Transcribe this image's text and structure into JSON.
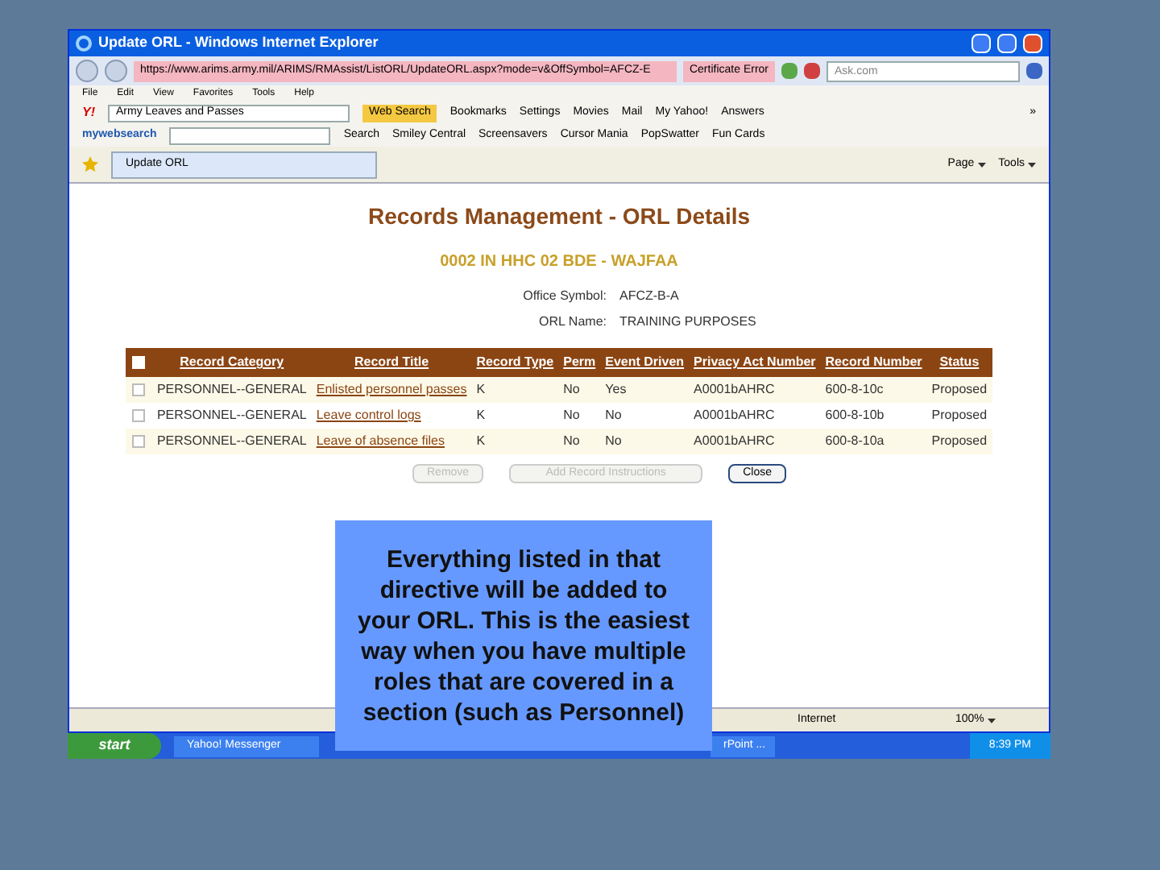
{
  "window": {
    "title": "Update ORL - Windows Internet Explorer"
  },
  "address_bar": {
    "url": "https://www.arims.army.mil/ARIMS/RMAssist/ListORL/UpdateORL.aspx?mode=v&OffSymbol=AFCZ-E",
    "certificate": "Certificate Error",
    "search_placeholder": "Ask.com"
  },
  "menu": [
    "File",
    "Edit",
    "View",
    "Favorites",
    "Tools",
    "Help"
  ],
  "yahoo_toolbar": {
    "logo": "Y!",
    "search_value": "Army Leaves and Passes",
    "search_button": "Web Search",
    "items": [
      "Bookmarks",
      "Settings",
      "Movies",
      "Mail",
      "My Yahoo!",
      "Answers"
    ],
    "more": "»"
  },
  "mywebsearch_toolbar": {
    "logo": "mywebsearch",
    "search_button": "Search",
    "items": [
      "Smiley Central",
      "Screensavers",
      "Cursor Mania",
      "PopSwatter",
      "Fun Cards"
    ]
  },
  "tab": {
    "label": "Update ORL"
  },
  "command_bar": [
    "Page",
    "Tools"
  ],
  "page": {
    "title": "Records Management - ORL Details",
    "subtitle": "0002 IN HHC 02 BDE - WAJFAA",
    "fields": [
      {
        "label": "Office Symbol:",
        "value": "AFCZ-B-A"
      },
      {
        "label": "ORL Name:",
        "value": "TRAINING PURPOSES"
      }
    ],
    "table": {
      "select_all_checked": false,
      "columns": [
        "Record Category",
        "Record Title",
        "Record Type",
        "Perm",
        "Event Driven",
        "Privacy Act Number",
        "Record Number",
        "Status"
      ],
      "rows": [
        {
          "checked": false,
          "cells": [
            "PERSONNEL--GENERAL",
            "Enlisted personnel passes",
            "K",
            "No",
            "Yes",
            "A0001bAHRC",
            "600-8-10c",
            "Proposed"
          ]
        },
        {
          "checked": false,
          "cells": [
            "PERSONNEL--GENERAL",
            "Leave control logs",
            "K",
            "No",
            "No",
            "A0001bAHRC",
            "600-8-10b",
            "Proposed"
          ]
        },
        {
          "checked": false,
          "cells": [
            "PERSONNEL--GENERAL",
            "Leave of absence files",
            "K",
            "No",
            "No",
            "A0001bAHRC",
            "600-8-10a",
            "Proposed"
          ]
        }
      ]
    },
    "buttons": [
      {
        "label": "Remove",
        "disabled": true
      },
      {
        "label": "Add Record Instructions",
        "disabled": true
      },
      {
        "label": "Close",
        "disabled": false
      }
    ]
  },
  "status_bar": {
    "zone": "Internet",
    "zoom": "100%"
  },
  "taskbar": {
    "start": "start",
    "items": [
      "Yahoo! Messenger",
      "rPoint ..."
    ],
    "time": "8:39 PM"
  },
  "callout": "Everything listed in that directive will be added to your ORL. This is the easiest way when you have multiple roles that are covered in a section (such as Personnel)"
}
